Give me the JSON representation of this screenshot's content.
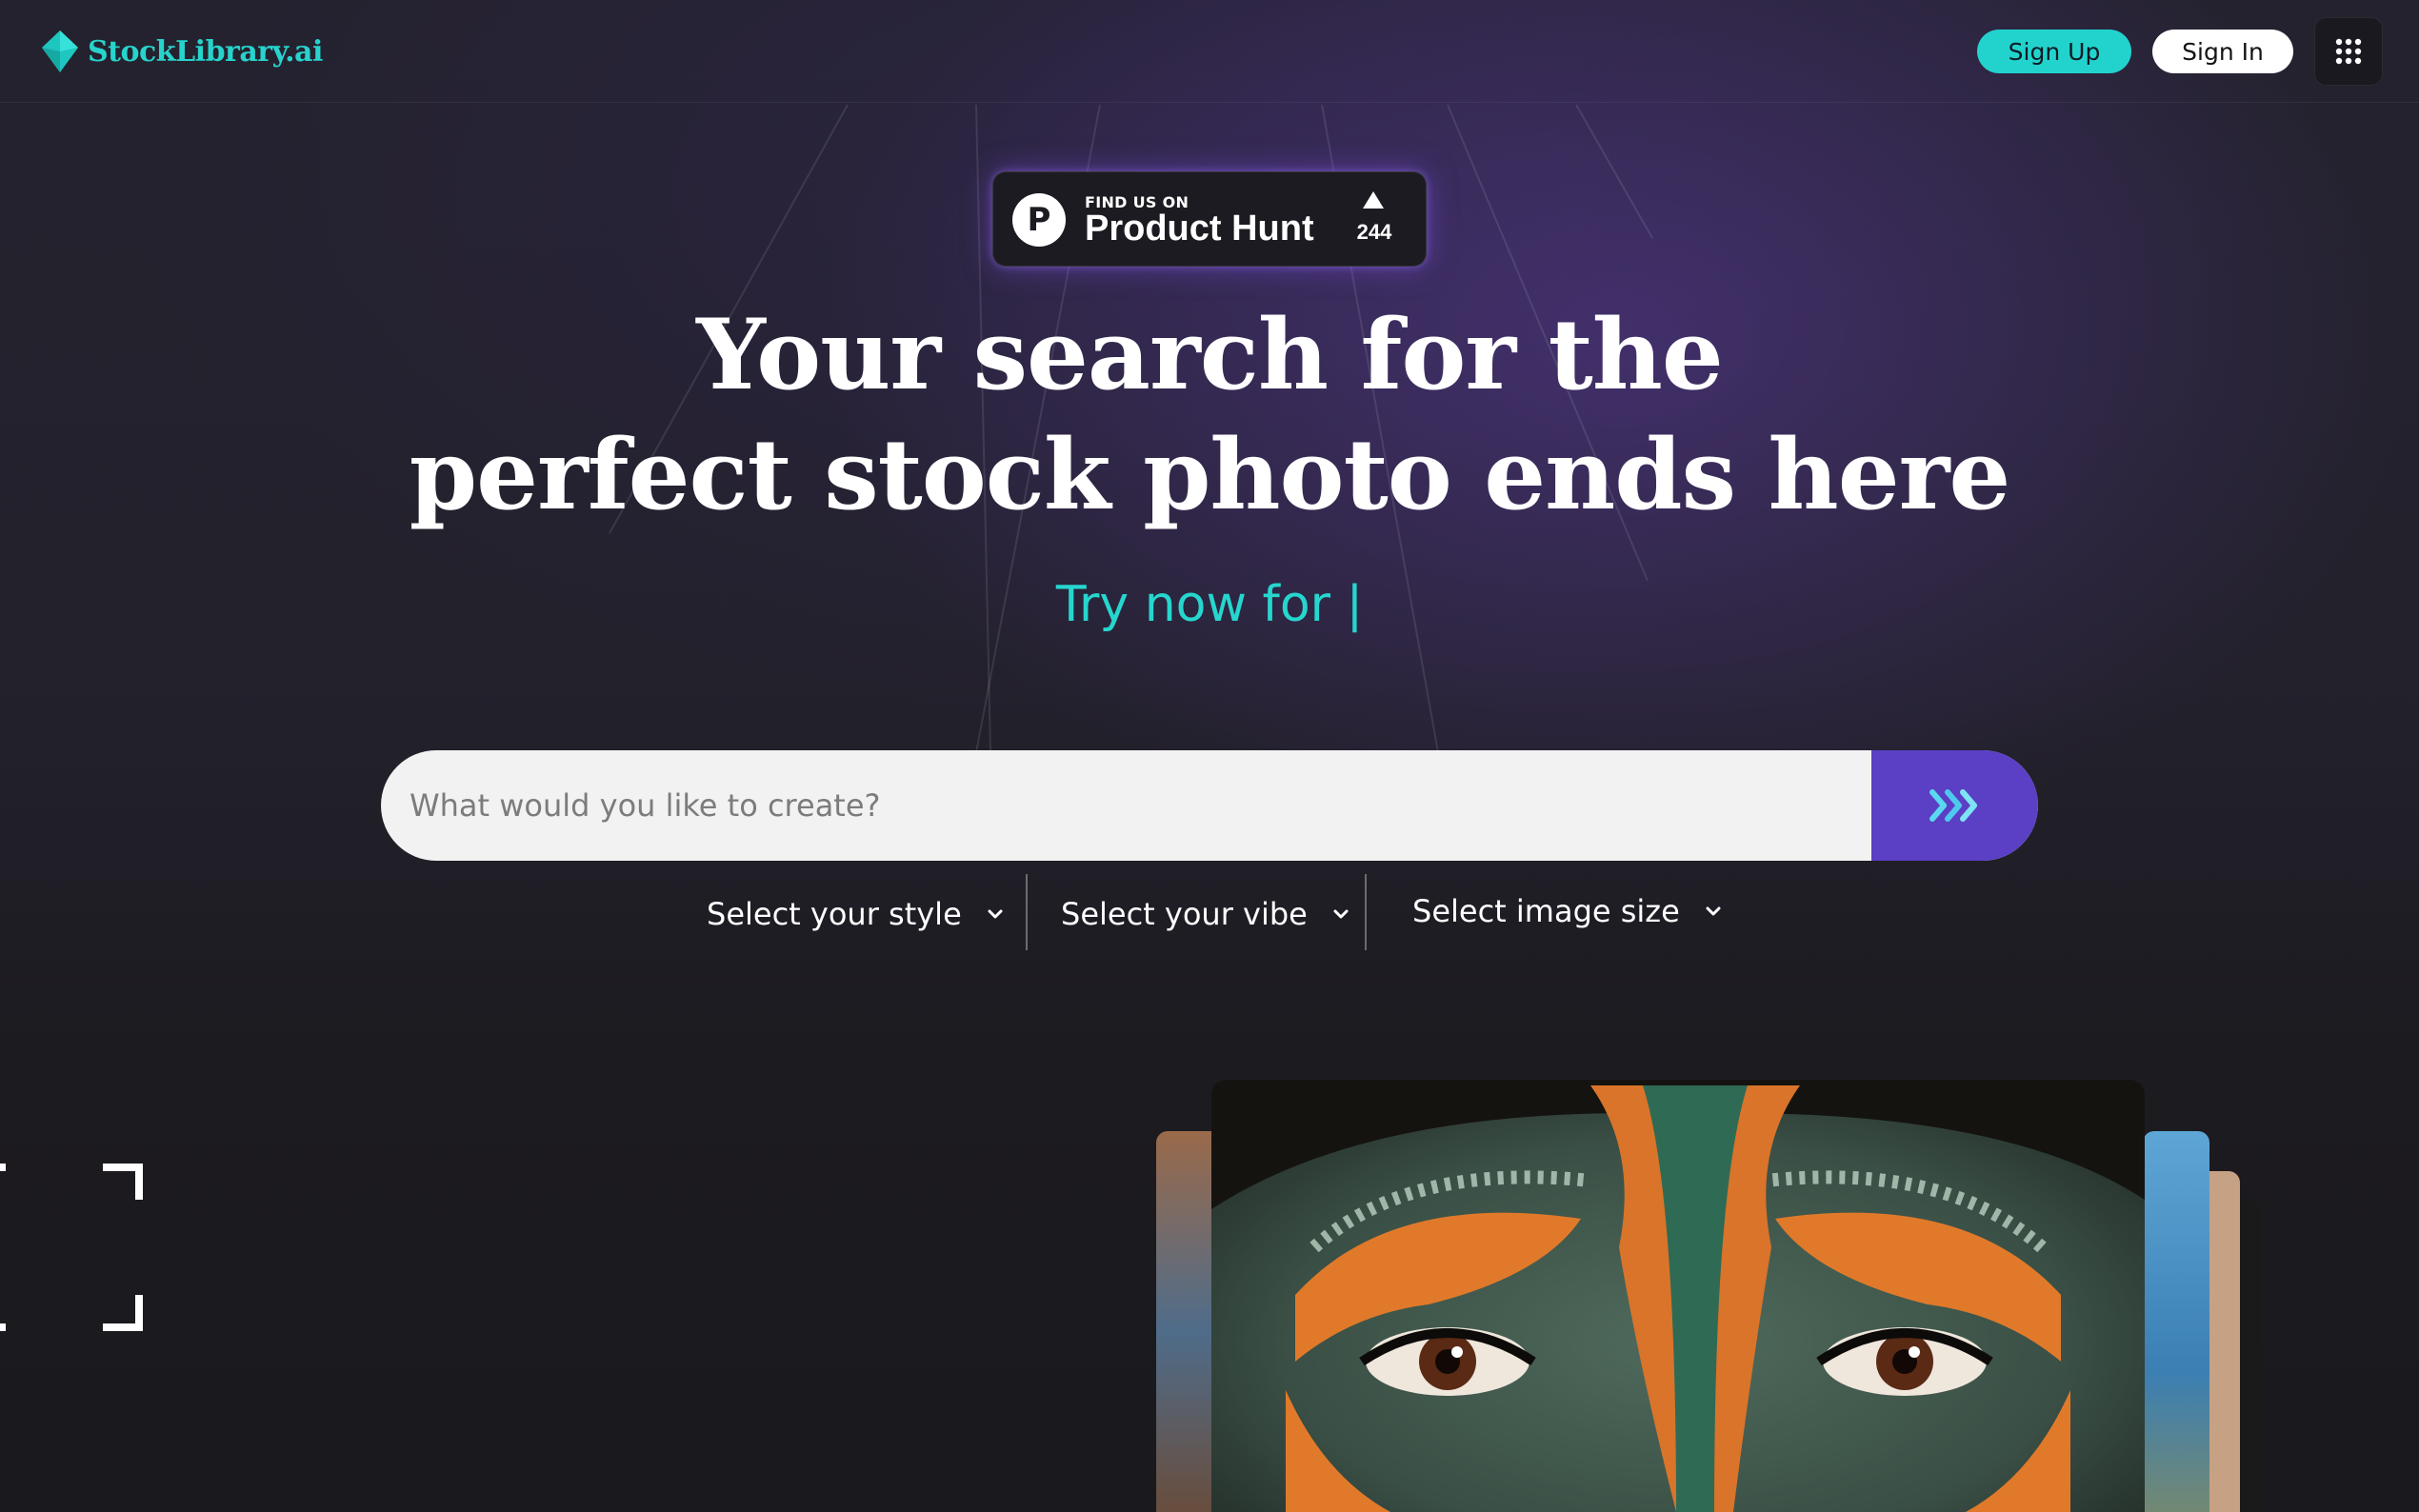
{
  "brand": {
    "name": "StockLibrary.ai",
    "accent_color": "#22d3cd",
    "purple_color": "#5b3fc4"
  },
  "header": {
    "signup_label": "Sign Up",
    "signin_label": "Sign In",
    "apps_icon": "grid-icon"
  },
  "product_hunt": {
    "small_text": "FIND US ON",
    "large_text": "Product Hunt",
    "logo_letter": "P",
    "upvotes": "244"
  },
  "hero": {
    "headline_line1": "Your search for the",
    "headline_line2": "perfect stock photo ends here",
    "tagline": "Try now for |"
  },
  "search": {
    "placeholder": "What would you like to create?",
    "submit_icon": "double-chevron-right-icon"
  },
  "filters": {
    "style_label": "Select your style",
    "vibe_label": "Select your vibe",
    "size_label": "Select image size"
  }
}
